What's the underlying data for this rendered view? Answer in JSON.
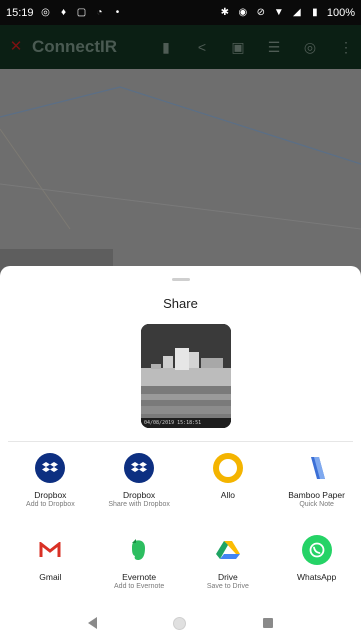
{
  "status_bar": {
    "time": "15:19",
    "battery": "100%",
    "left_icons": [
      "whatsapp-icon",
      "stream-icon",
      "tablet-icon",
      "chart-icon",
      "dot-icon"
    ],
    "right_icons": [
      "bluetooth-icon",
      "location-icon",
      "silent-icon",
      "wifi-icon",
      "signal-icon",
      "battery-icon"
    ]
  },
  "app_bar": {
    "title": "ConnectIR",
    "actions": [
      "delete-icon",
      "share-icon",
      "image-icon",
      "list-icon",
      "target-icon",
      "more-icon"
    ]
  },
  "share_sheet": {
    "title": "Share",
    "preview_caption": "04/08/2019 15:18:51",
    "rows": [
      [
        {
          "name": "Dropbox",
          "sub": "Add to Dropbox",
          "icon": "dropbox-icon",
          "color": "#0d2f81"
        },
        {
          "name": "Dropbox",
          "sub": "Share with Dropbox",
          "icon": "dropbox-icon",
          "color": "#0d2f81"
        },
        {
          "name": "Allo",
          "sub": "",
          "icon": "allo-icon",
          "color": "#f4b400"
        },
        {
          "name": "Bamboo Paper",
          "sub": "Quick Note",
          "icon": "bamboo-paper-icon",
          "color": "#3b6fd6"
        }
      ],
      [
        {
          "name": "Gmail",
          "sub": "",
          "icon": "gmail-icon",
          "color": "#d93025"
        },
        {
          "name": "Evernote",
          "sub": "Add to Evernote",
          "icon": "evernote-icon",
          "color": "#2dbe60"
        },
        {
          "name": "Drive",
          "sub": "Save to Drive",
          "icon": "drive-icon",
          "color": "#1fa463"
        },
        {
          "name": "WhatsApp",
          "sub": "",
          "icon": "whatsapp-icon",
          "color": "#25d366"
        }
      ]
    ]
  },
  "nav_bar": {
    "buttons": [
      "back-icon",
      "home-icon",
      "recents-icon"
    ]
  }
}
